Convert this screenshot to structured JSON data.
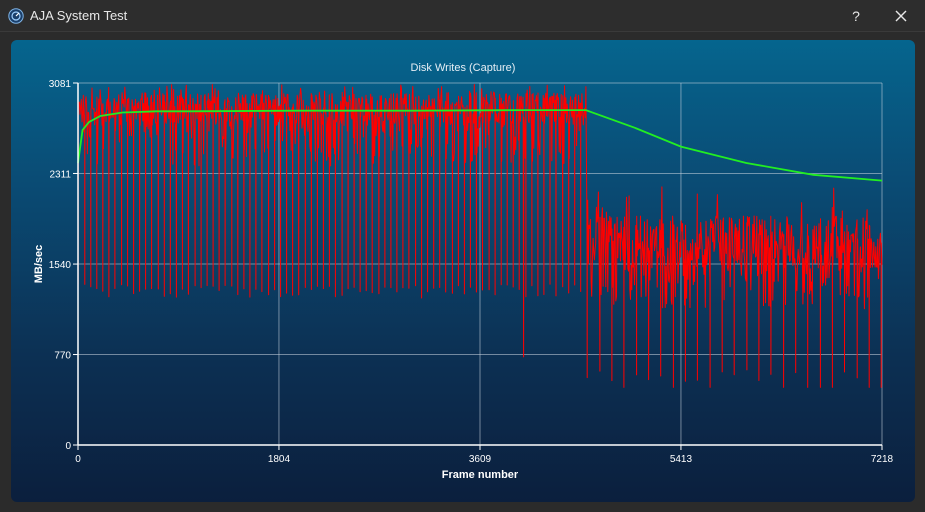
{
  "window": {
    "title": "AJA System Test",
    "help_label": "?",
    "app_icon": "aja-logo-icon",
    "close_icon": "close-icon"
  },
  "colors": {
    "write_rate": "#ff0000",
    "average": "#22ee22",
    "grid": "#c9d4df",
    "axis": "#ffffff"
  },
  "chart_data": {
    "type": "line",
    "title": "Disk Writes (Capture)",
    "xlabel": "Frame number",
    "ylabel": "MB/sec",
    "xlim": [
      0,
      7218
    ],
    "ylim": [
      0,
      3081
    ],
    "x_ticks": [
      "0",
      "1804",
      "3609",
      "5413",
      "7218"
    ],
    "y_ticks": [
      "0",
      "770",
      "1540",
      "2311",
      "3081"
    ],
    "grid": true,
    "series": [
      {
        "role": "per-frame write rate",
        "color": "#ff0000",
        "segments": [
          {
            "x_start": 0,
            "x_end": 4560,
            "typical_min": 2720,
            "typical_max": 3000,
            "peak": 3070,
            "periodic_dips_to": 1250,
            "dip_interval_frames": 55
          },
          {
            "x_start": 4570,
            "x_end": 7218,
            "typical_min": 1500,
            "typical_max": 1950,
            "peak": 2220,
            "periodic_dips_to": 520,
            "lowest": 490,
            "dip_interval_frames": 110
          }
        ],
        "isolated_dip": {
          "x": 4000,
          "y": 750
        }
      },
      {
        "role": "running average",
        "color": "#22ee22",
        "x": [
          0,
          40,
          100,
          200,
          400,
          700,
          1000,
          2000,
          3000,
          4000,
          4560,
          5000,
          5413,
          6000,
          6600,
          7218
        ],
        "y": [
          2400,
          2680,
          2750,
          2800,
          2830,
          2840,
          2840,
          2845,
          2845,
          2850,
          2850,
          2700,
          2540,
          2400,
          2300,
          2250
        ]
      }
    ]
  }
}
